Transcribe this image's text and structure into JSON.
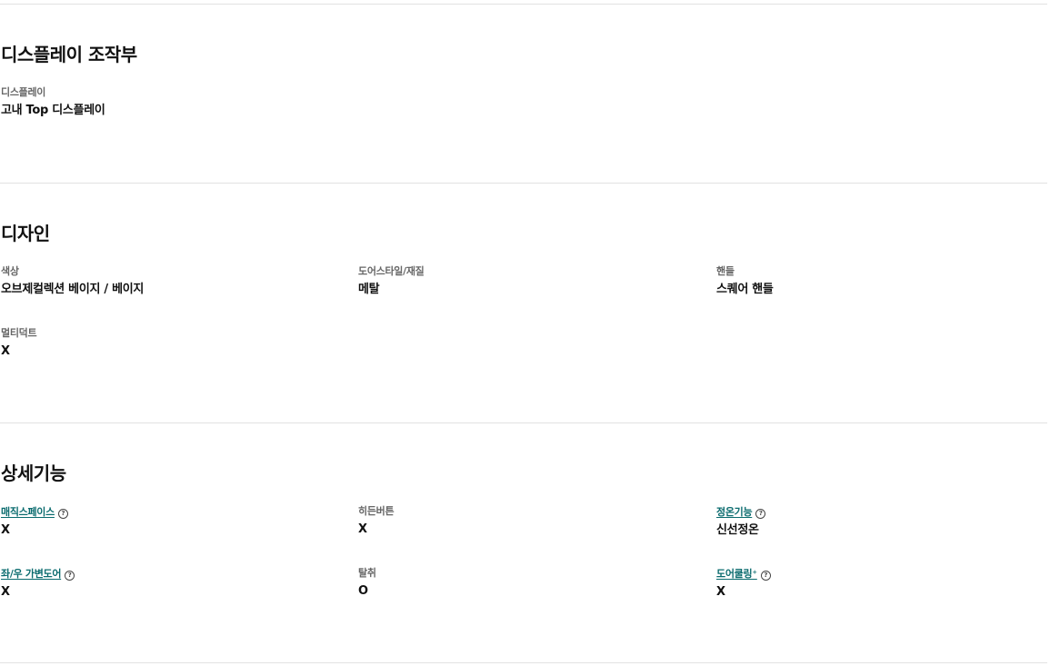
{
  "display_section": {
    "title": "디스플레이 조작부",
    "specs": [
      {
        "label": "디스플레이",
        "value": "고내 Top 디스플레이"
      }
    ]
  },
  "design_section": {
    "title": "디자인",
    "specs": [
      {
        "label": "색상",
        "value": "오브제컬렉션 베이지 / 베이지"
      },
      {
        "label": "도어스타일/재질",
        "value": "메탈"
      },
      {
        "label": "핸들",
        "value": "스퀘어 핸들"
      },
      {
        "label": "멀티덕트",
        "value": "X"
      }
    ]
  },
  "features_section": {
    "title": "상세기능",
    "specs": [
      {
        "label": "매직스페이스",
        "value": "X",
        "link": true,
        "help_icon": "question-circle-icon"
      },
      {
        "label": "히든버튼",
        "value": "X"
      },
      {
        "label": "정온기능",
        "value": "신선정온",
        "link": true,
        "help_icon": "question-circle-icon"
      },
      {
        "label": "좌/우 가변도어",
        "value": "X",
        "link": true,
        "help_icon": "question-circle-icon"
      },
      {
        "label": "탈취",
        "value": "O"
      },
      {
        "label": "도어쿨링⁺",
        "value": "X",
        "link": true,
        "help_icon": "question-circle-icon"
      }
    ]
  },
  "colors": {
    "link": "#0a6b6e",
    "label": "#666666",
    "value": "#111111",
    "divider": "#e2e2e2"
  }
}
